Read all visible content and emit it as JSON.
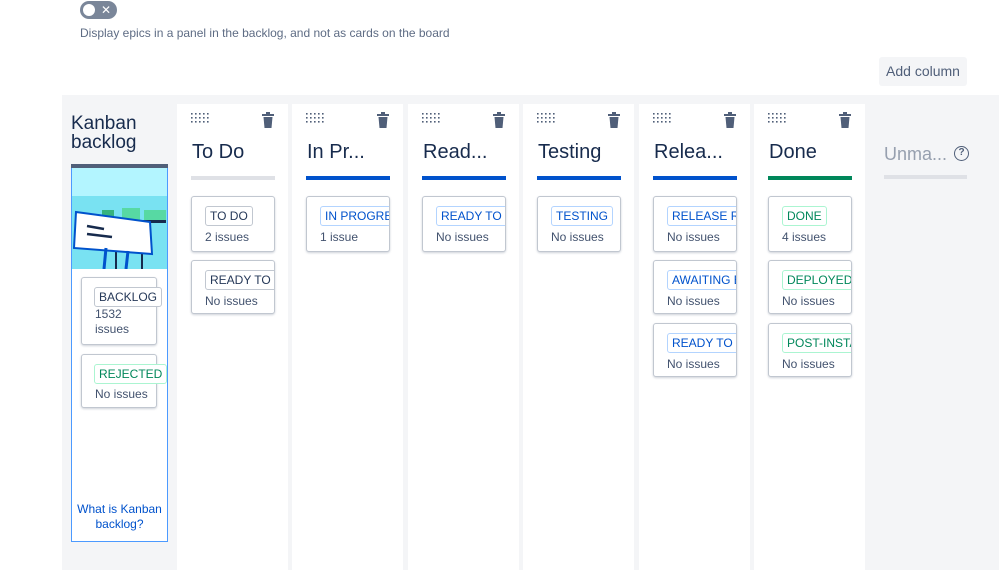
{
  "settings": {
    "epics_toggle_icon": "x-icon",
    "epics_description": "Display epics in a panel in the backlog, and not as cards on the board",
    "add_column_label": "Add column"
  },
  "backlog": {
    "title_line1": "Kanban",
    "title_line2": "backlog",
    "cards": [
      {
        "status": "BACKLOG",
        "count": "1532 issues",
        "color": "grey"
      },
      {
        "status": "REJECTED",
        "count": "No issues",
        "color": "green"
      }
    ],
    "link_text_line1": "What is Kanban",
    "link_text_line2": "backlog?"
  },
  "columns": [
    {
      "title": "To Do",
      "bar": "grey",
      "cards": [
        {
          "status": "TO DO",
          "count": "2 issues",
          "color": "grey"
        },
        {
          "status": "READY TO GO",
          "count": "No issues",
          "color": "grey"
        }
      ]
    },
    {
      "title": "In Pr...",
      "bar": "blue",
      "cards": [
        {
          "status": "IN PROGRESS",
          "count": "1 issue",
          "color": "blue"
        }
      ]
    },
    {
      "title": "Read...",
      "bar": "blue",
      "cards": [
        {
          "status": "READY TO TEST",
          "count": "No issues",
          "color": "blue"
        }
      ]
    },
    {
      "title": "Testing",
      "bar": "blue",
      "cards": [
        {
          "status": "TESTING",
          "count": "No issues",
          "color": "blue"
        }
      ]
    },
    {
      "title": "Relea...",
      "bar": "blue",
      "cards": [
        {
          "status": "RELEASE READY",
          "count": "No issues",
          "color": "blue"
        },
        {
          "status": "AWAITING BUILD",
          "count": "No issues",
          "color": "blue"
        },
        {
          "status": "READY TO DEPLOY",
          "count": "No issues",
          "color": "blue"
        }
      ]
    },
    {
      "title": "Done",
      "bar": "green",
      "cards": [
        {
          "status": "DONE",
          "count": "4 issues",
          "color": "green"
        },
        {
          "status": "DEPLOYED",
          "count": "No issues",
          "color": "green"
        },
        {
          "status": "POST-INSTALL",
          "count": "No issues",
          "color": "green"
        }
      ]
    }
  ],
  "unmapped": {
    "title": "Unma...",
    "help_icon": "help-icon"
  },
  "colors": {
    "blue": "#0052cc",
    "green": "#00875a",
    "board_bg": "#f4f5f7"
  }
}
